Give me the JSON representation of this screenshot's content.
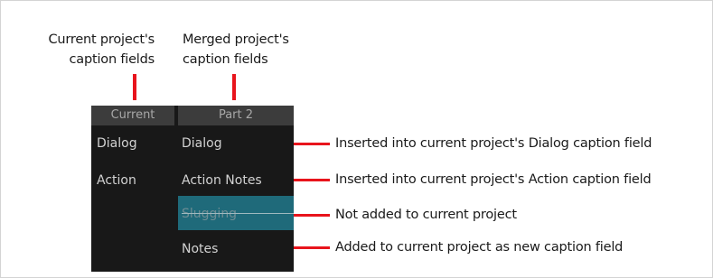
{
  "callouts": {
    "current_line1": "Current project's",
    "current_line2": "caption fields",
    "merged_line1": "Merged project's",
    "merged_line2": "caption fields"
  },
  "panel": {
    "header_current": "Current",
    "header_merged": "Part 2",
    "current_fields": [
      "Dialog",
      "Action"
    ],
    "merged_fields": [
      "Dialog",
      "Action Notes",
      "Slugging",
      "Notes"
    ]
  },
  "annotations": [
    "Inserted into current project's Dialog caption field",
    "Inserted into current project's Action caption field",
    "Not added to current project",
    "Added to current project as new caption field"
  ],
  "colors": {
    "accent_red": "#e8141c",
    "panel_bg": "#181818",
    "header_bg": "#3c3c3c",
    "highlight": "#1f6a7a"
  }
}
